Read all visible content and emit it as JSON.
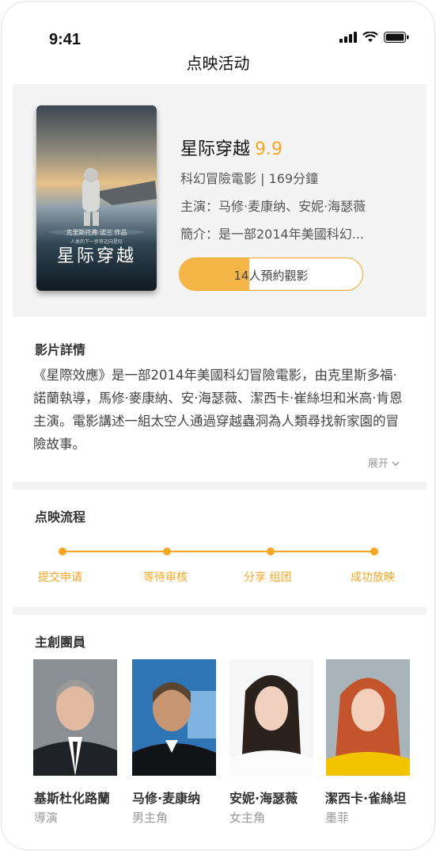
{
  "status": {
    "time": "9:41"
  },
  "nav": {
    "title": "点映活动"
  },
  "film": {
    "poster_title": "星际穿越",
    "poster_sub": "克里斯托弗·诺兰 作品",
    "poster_tagline": "人类的下一步将迈向星际",
    "name": "星际穿越",
    "score": "9.9",
    "meta": "科幻冒險電影 | 169分鐘",
    "cast_line": "主演：马修·麦康纳、安妮·海瑟薇",
    "intro": "簡介：是一部2014年美國科幻...",
    "reserve_label": "14人預約觀影",
    "reserve_progress": 0.38
  },
  "detail": {
    "title": "影片詳情",
    "text": "《星際效應》是一部2014年美國科幻冒險電影，由克里斯多福·諾蘭執導，馬修·麥康納、安·海瑟薇、潔西卡·崔絲坦和米高·肯恩主演。電影講述一組太空人通過穿越蟲洞為人類尋找新家園的冒險故事。",
    "expand_label": "展开"
  },
  "process": {
    "title": "点映流程",
    "steps": [
      "提交申请",
      "等待审核",
      "分享 组团",
      "成功放映"
    ]
  },
  "cast": {
    "title": "主創團員",
    "members": [
      {
        "name": "基斯杜化路蘭",
        "role": "導演"
      },
      {
        "name": "马修·麦康纳",
        "role": "男主角"
      },
      {
        "name": "安妮·海瑟薇",
        "role": "女主角"
      },
      {
        "name": "潔西卡·雀絲坦",
        "role": "墨菲"
      }
    ]
  },
  "colors": {
    "accent": "#f5a623",
    "panel": "#f4f4f4"
  }
}
